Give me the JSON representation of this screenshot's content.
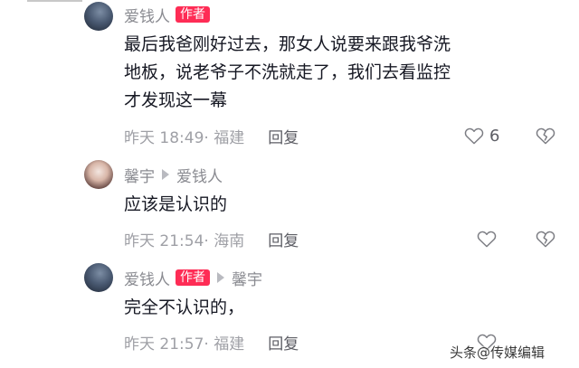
{
  "comments": [
    {
      "author": "爱钱人",
      "badge": "作者",
      "text": "最后我爸刚好过去，那女人说要来跟我爷洗地板，说老爷子不洗就走了，我们去看监控才发现这一幕",
      "time": "昨天 18:49",
      "location": "· 福建",
      "reply_label": "回复",
      "likes": "6"
    },
    {
      "author": "馨宇",
      "reply_to": "爱钱人",
      "text": "应该是认识的",
      "time": "昨天 21:54",
      "location": "· 海南",
      "reply_label": "回复"
    },
    {
      "author": "爱钱人",
      "badge": "作者",
      "reply_to": "馨宇",
      "text": "完全不认识的，",
      "time": "昨天 21:57",
      "location": "· 福建",
      "reply_label": "回复"
    }
  ],
  "watermark": "头条@传媒编辑",
  "colors": {
    "badge": "#fe2c55",
    "meta": "#9fa0a6",
    "text": "#161823"
  },
  "icons": {
    "like": "heart-outline-icon",
    "dislike": "broken-heart-icon",
    "reply_to": "triangle-right-icon"
  }
}
